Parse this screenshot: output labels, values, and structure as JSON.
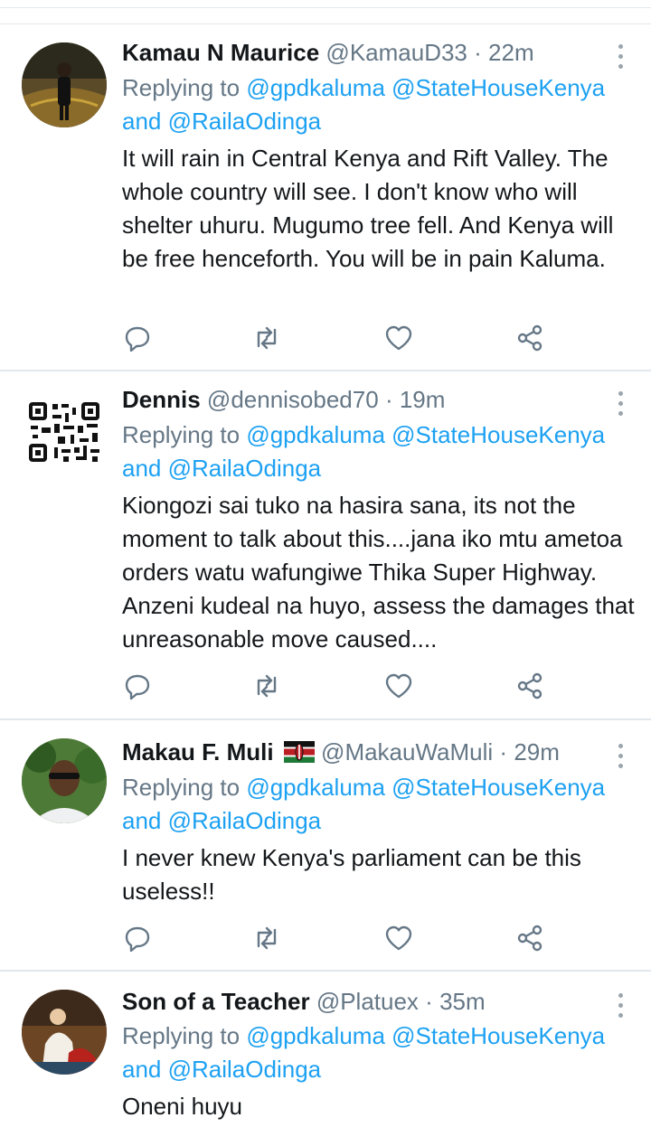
{
  "tweets": [
    {
      "name": "Kamau N Maurice",
      "handle": "@KamauD33",
      "separator": "·",
      "time": "22m",
      "replying_prefix": "Replying to",
      "mention1": "@gpdkaluma",
      "mention2": "@StateHouseKenya",
      "and": "and",
      "mention3": "@RailaOdinga",
      "body": "It will rain in Central Kenya and Rift Valley. The whole country will see. I don't know who will shelter uhuru. Mugumo tree fell. And Kenya will be free henceforth. You will be in pain Kaluma."
    },
    {
      "name": "Dennis",
      "handle": "@dennisobed70",
      "separator": "·",
      "time": "19m",
      "replying_prefix": "Replying to",
      "mention1": "@gpdkaluma",
      "mention2": "@StateHouseKenya",
      "and": "and",
      "mention3": "@RailaOdinga",
      "body": "Kiongozi sai tuko na hasira sana, its not the moment to talk about this....jana iko mtu ametoa orders watu wafungiwe Thika Super Highway. Anzeni kudeal na huyo, assess the damages that unreasonable move caused...."
    },
    {
      "name": "Makau F. Muli",
      "handle": "@MakauWaMuli",
      "separator": "·",
      "time": "29m",
      "replying_prefix": "Replying to",
      "mention1": "@gpdkaluma",
      "mention2": "@StateHouseKenya",
      "and": "and",
      "mention3": "@RailaOdinga",
      "body": "I never knew Kenya's parliament can be this useless!!"
    },
    {
      "name": "Son of a Teacher",
      "handle": "@Platuex",
      "separator": "·",
      "time": "35m",
      "replying_prefix": "Replying to",
      "mention1": "@gpdkaluma",
      "mention2": "@StateHouseKenya",
      "and": "and",
      "mention3": "@RailaOdinga",
      "body": "Oneni huyu"
    }
  ],
  "icons": {
    "reply": "reply-icon",
    "retweet": "retweet-icon",
    "like": "heart-icon",
    "share": "share-icon",
    "more": "more-vertical-icon"
  },
  "colors": {
    "link": "#1da1f2",
    "secondary": "#657786",
    "text": "#14171a",
    "divider": "#e1e8ed"
  }
}
